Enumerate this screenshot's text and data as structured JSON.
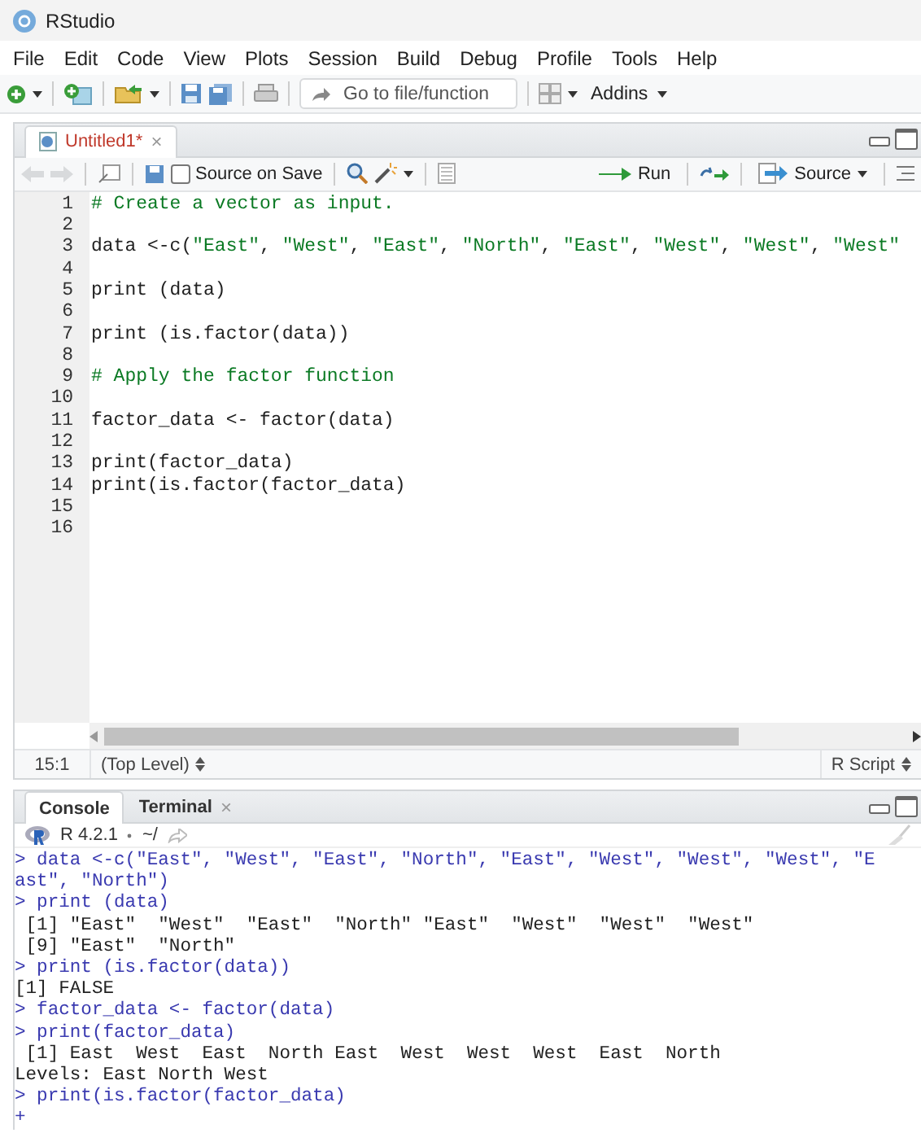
{
  "window": {
    "title": "RStudio"
  },
  "menu": [
    "File",
    "Edit",
    "Code",
    "View",
    "Plots",
    "Session",
    "Build",
    "Debug",
    "Profile",
    "Tools",
    "Help"
  ],
  "toolbar": {
    "goto_placeholder": "Go to file/function",
    "addins": "Addins"
  },
  "editor": {
    "tabs": [
      {
        "label": "Untitled1*",
        "close": "×",
        "selected": true,
        "unsaved": true
      }
    ],
    "source_on_save": {
      "label": "Source on Save",
      "checked": false
    },
    "run": "Run",
    "source": "Source",
    "lines": [
      {
        "number": "1",
        "tokens": [
          {
            "kind": "comment",
            "text": "# Create a vector as input."
          }
        ]
      },
      {
        "number": "2"
      },
      {
        "number": "3",
        "tokens": [
          {
            "kind": "code",
            "text": "data <-c("
          },
          {
            "kind": "string",
            "text": "\"East\""
          },
          {
            "kind": "code",
            "text": ", "
          },
          {
            "kind": "string",
            "text": "\"West\""
          },
          {
            "kind": "code",
            "text": ", "
          },
          {
            "kind": "string",
            "text": "\"East\""
          },
          {
            "kind": "code",
            "text": ", "
          },
          {
            "kind": "string",
            "text": "\"North\""
          },
          {
            "kind": "code",
            "text": ", "
          },
          {
            "kind": "string",
            "text": "\"East\""
          },
          {
            "kind": "code",
            "text": ", "
          },
          {
            "kind": "string",
            "text": "\"West\""
          },
          {
            "kind": "code",
            "text": ", "
          },
          {
            "kind": "string",
            "text": "\"West\""
          },
          {
            "kind": "code",
            "text": ", "
          },
          {
            "kind": "string",
            "text": "\"West\""
          }
        ]
      },
      {
        "number": "4"
      },
      {
        "number": "5",
        "tokens": [
          {
            "kind": "code",
            "text": "print (data)"
          }
        ]
      },
      {
        "number": "6"
      },
      {
        "number": "7",
        "tokens": [
          {
            "kind": "code",
            "text": "print (is.factor(data))"
          }
        ]
      },
      {
        "number": "8"
      },
      {
        "number": "9",
        "tokens": [
          {
            "kind": "comment",
            "text": "# Apply the factor function"
          }
        ]
      },
      {
        "number": "10"
      },
      {
        "number": "11",
        "tokens": [
          {
            "kind": "code",
            "text": "factor_data <- factor(data)"
          }
        ]
      },
      {
        "number": "12"
      },
      {
        "number": "13",
        "tokens": [
          {
            "kind": "code",
            "text": "print(factor_data)"
          }
        ]
      },
      {
        "number": "14",
        "tokens": [
          {
            "kind": "code",
            "text": "print(is.factor(factor_data)"
          }
        ]
      },
      {
        "number": "15"
      },
      {
        "number": "16"
      }
    ],
    "status": {
      "position": "15:1",
      "scope": "(Top Level)",
      "file_type": "R Script"
    }
  },
  "console": {
    "tabs": [
      {
        "label": "Console",
        "selected": true
      },
      {
        "label": "Terminal",
        "close": "×",
        "selected": false
      }
    ],
    "version": "R 4.2.1",
    "path": "~/",
    "lines": [
      {
        "kind": "input",
        "text": "> data <-c(\"East\", \"West\", \"East\", \"North\", \"East\", \"West\", \"West\", \"West\", \"E"
      },
      {
        "kind": "input",
        "text": "ast\", \"North\")"
      },
      {
        "kind": "input",
        "text": "> print (data)"
      },
      {
        "kind": "output",
        "text": " [1] \"East\"  \"West\"  \"East\"  \"North\" \"East\"  \"West\"  \"West\"  \"West\""
      },
      {
        "kind": "output",
        "text": " [9] \"East\"  \"North\""
      },
      {
        "kind": "input",
        "text": "> print (is.factor(data))"
      },
      {
        "kind": "output",
        "text": "[1] FALSE"
      },
      {
        "kind": "input",
        "text": "> factor_data <- factor(data)"
      },
      {
        "kind": "input",
        "text": "> print(factor_data)"
      },
      {
        "kind": "output",
        "text": " [1] East  West  East  North East  West  West  West  East  North"
      },
      {
        "kind": "output",
        "text": "Levels: East North West"
      },
      {
        "kind": "input",
        "text": "> print(is.factor(factor_data)"
      },
      {
        "kind": "input",
        "text": "+"
      }
    ]
  }
}
